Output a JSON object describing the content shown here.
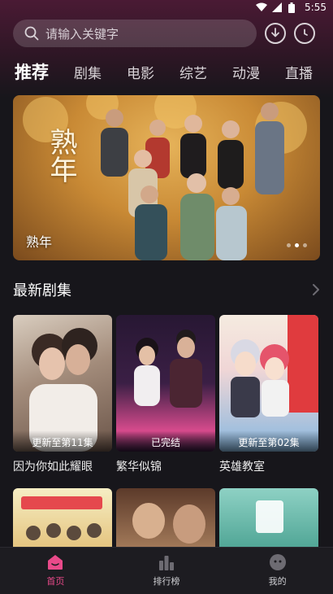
{
  "status_bar": {
    "time": "5:55"
  },
  "search": {
    "placeholder": "请输入关键字"
  },
  "tabs": [
    {
      "label": "推荐",
      "active": true
    },
    {
      "label": "剧集"
    },
    {
      "label": "电影"
    },
    {
      "label": "综艺"
    },
    {
      "label": "动漫"
    },
    {
      "label": "直播"
    }
  ],
  "banner": {
    "title_art": "熟年",
    "caption": "熟年",
    "dots": 3,
    "active_dot": 2
  },
  "section": {
    "title": "最新剧集"
  },
  "cards": [
    {
      "title": "因为你如此耀眼",
      "tag": "更新至第11集"
    },
    {
      "title": "繁华似锦",
      "tag": "已完结"
    },
    {
      "title": "英雄教室",
      "tag": "更新至第02集"
    }
  ],
  "bottom_nav": [
    {
      "label": "首页",
      "icon": "home-icon",
      "active": true
    },
    {
      "label": "排行榜",
      "icon": "chart-icon"
    },
    {
      "label": "我的",
      "icon": "profile-icon"
    }
  ],
  "colors": {
    "accent": "#e94a8a",
    "background": "#17161b"
  }
}
